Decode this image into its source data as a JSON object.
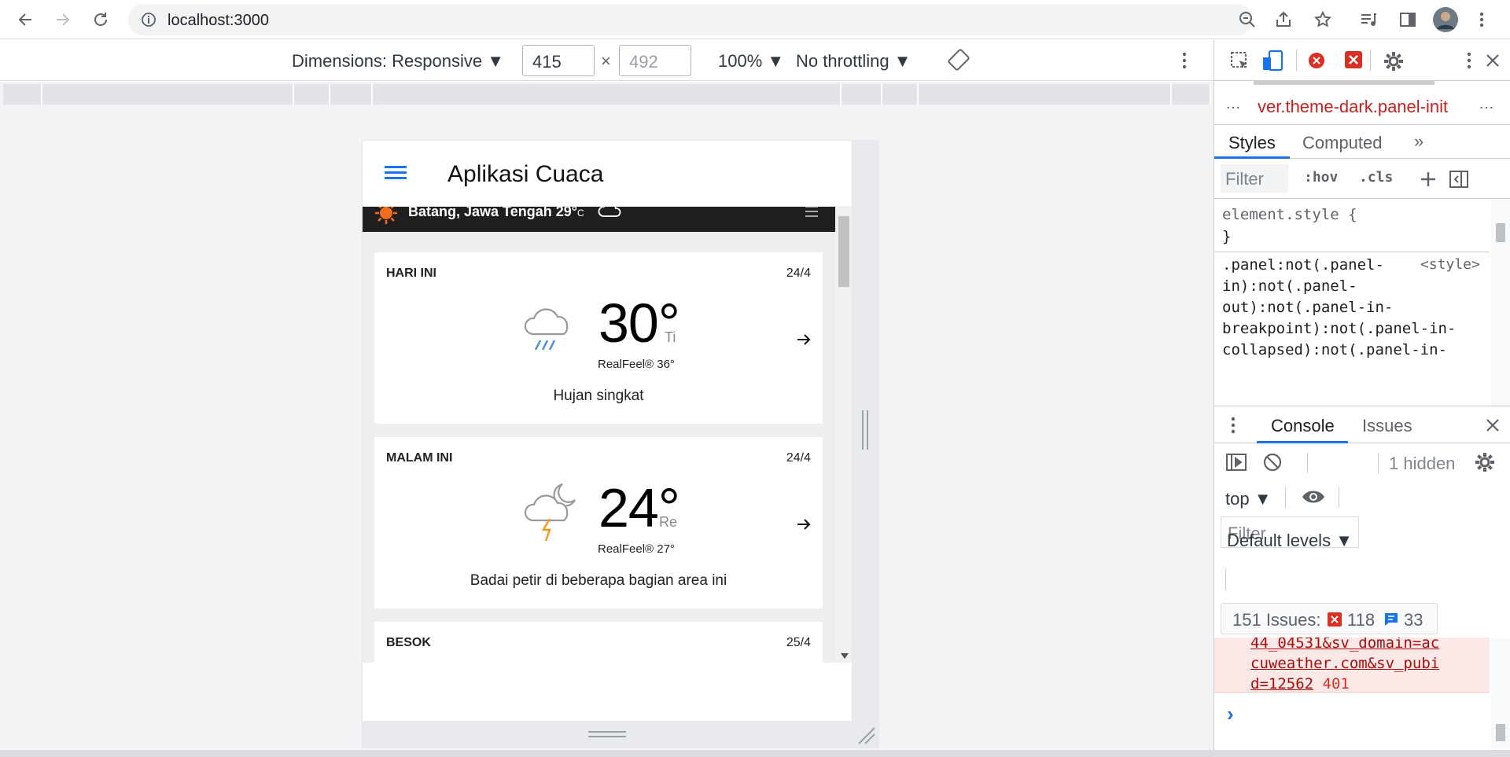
{
  "browser": {
    "url": "localhost:3000",
    "colors": {
      "accent": "#1a73e8"
    }
  },
  "device_toolbar": {
    "dimensions_label": "Dimensions: Responsive",
    "width_value": "415",
    "height_placeholder": "492",
    "times": "×",
    "zoom": "100%",
    "throttling": "No throttling"
  },
  "app": {
    "title": "Aplikasi Cuaca",
    "location_bar": "Batang, Jawa Tengah  29°",
    "location_unit": "C",
    "cards": [
      {
        "label": "HARI INI",
        "date": "24/4",
        "temp": "30°",
        "unit": "Ti",
        "realfeel": "RealFeel® 36°",
        "desc": "Hujan singkat",
        "icon": "rain-cloud-icon"
      },
      {
        "label": "MALAM INI",
        "date": "24/4",
        "temp": "24°",
        "unit": "Re",
        "realfeel": "RealFeel® 27°",
        "desc": "Badai petir di beberapa bagian area ini",
        "icon": "night-storm-icon"
      },
      {
        "label": "BESOK",
        "date": "25/4"
      }
    ]
  },
  "devtools": {
    "breadcrumb": "ver.theme-dark.panel-init",
    "ellipsis": "…",
    "tabs": {
      "styles": "Styles",
      "computed": "Computed",
      "more": "»"
    },
    "filter_placeholder": "Filter",
    "hov": ":hov",
    "cls": ".cls",
    "element_style": "element.style {",
    "close_brace": "}",
    "rule_lines": [
      ".panel:not(.panel-",
      "in):not(.panel-",
      "out):not(.panel-in-",
      "breakpoint):not(.panel-in-",
      "collapsed):not(.panel-in-"
    ],
    "rule_source": "<style>",
    "drawer_tabs": {
      "console": "Console",
      "issues": "Issues"
    },
    "hidden_count": "1 hidden",
    "context": "top",
    "console_filter_placeholder": "Filter",
    "levels": "Default levels",
    "issues_summary": "151 Issues:",
    "issues_errors": "118",
    "issues_info": "33",
    "log_lines": [
      "44_04531&sv_domain=ac",
      "cuweather.com&sv_pubi",
      "d=12562"
    ],
    "log_status": "401",
    "prompt": "›"
  }
}
